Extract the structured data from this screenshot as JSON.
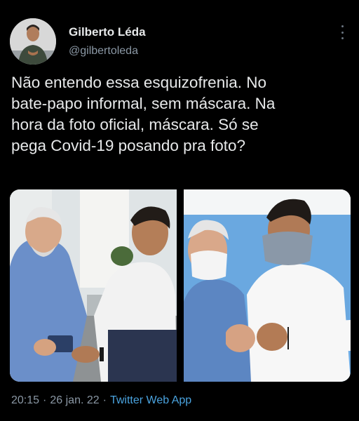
{
  "author": {
    "name": "Gilberto Léda",
    "handle": "@gilbertoleda"
  },
  "tweet": {
    "text": "Não entendo essa esquizofrenia. No\nbate-papo informal, sem máscara. Na\nhora da foto oficial, máscara. Só se\npega Covid-19 posando pra foto?"
  },
  "meta": {
    "time": "20:15",
    "date": "26 jan. 22",
    "separator": "·",
    "app": "Twitter Web App"
  },
  "icons": {
    "more": "more-vertical-icon"
  },
  "colors": {
    "background": "#000000",
    "text": "#e7e9ea",
    "secondary": "#8b98a5",
    "link": "#4aa3df"
  }
}
